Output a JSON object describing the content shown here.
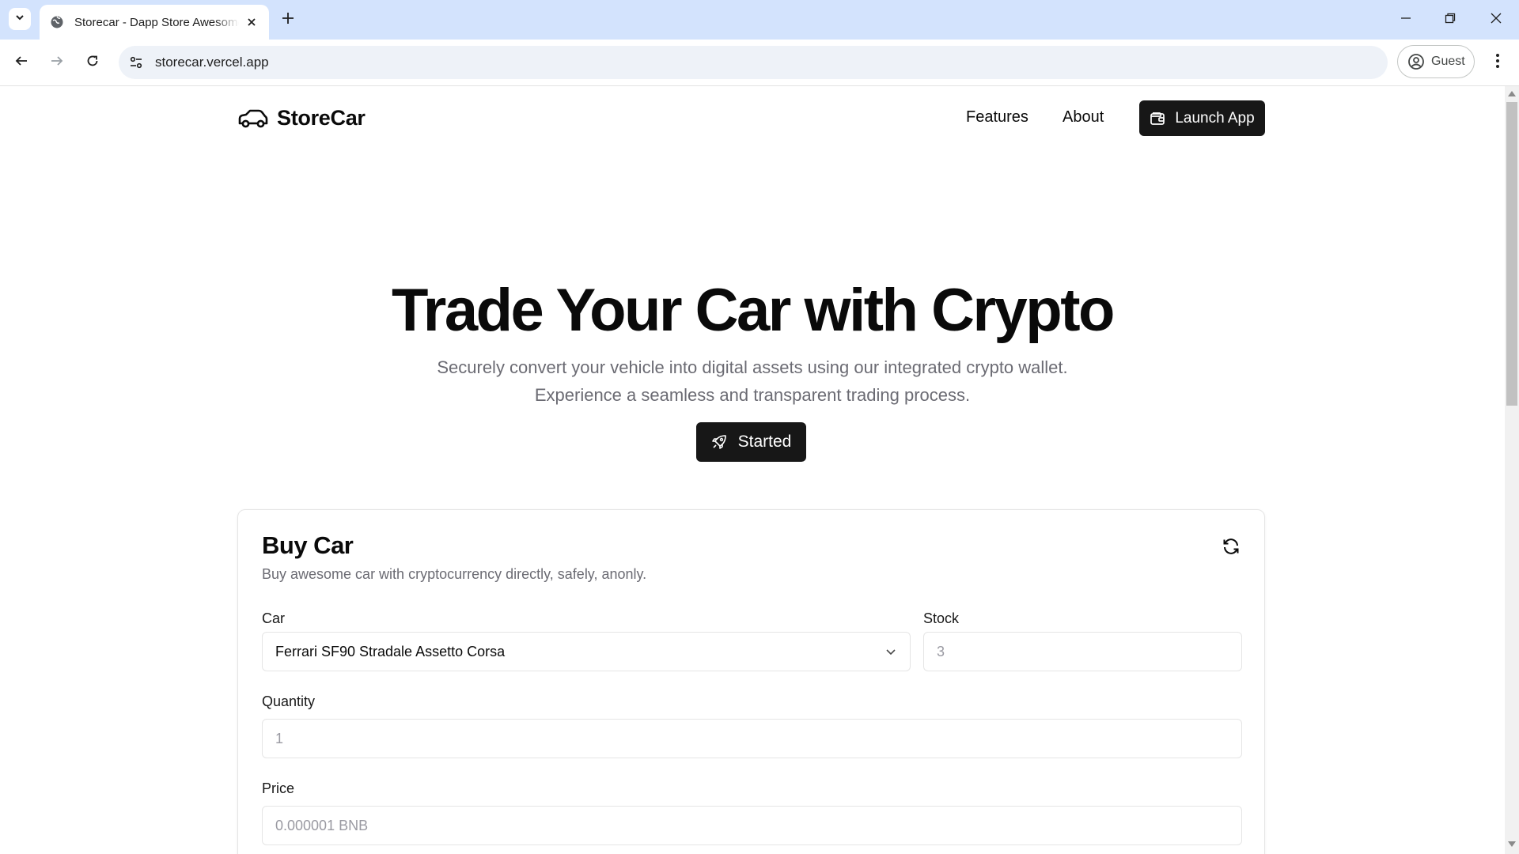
{
  "browser": {
    "tab_title": "Storecar - Dapp Store Awesome",
    "url": "storecar.vercel.app",
    "profile_label": "Guest"
  },
  "site": {
    "brand": "StoreCar",
    "nav": [
      "Features",
      "About"
    ],
    "launch_label": "Launch App"
  },
  "hero": {
    "title": "Trade Your Car with Crypto",
    "subtitle_line1": "Securely convert your vehicle into digital assets using our integrated crypto wallet.",
    "subtitle_line2": "Experience a seamless and transparent trading process.",
    "cta_label": "Started"
  },
  "buy_card": {
    "title": "Buy Car",
    "description": "Buy awesome car with cryptocurrency directly, safely, anonly.",
    "car_label": "Car",
    "car_selected": "Ferrari SF90 Stradale Assetto Corsa",
    "stock_label": "Stock",
    "stock_placeholder": "3",
    "quantity_label": "Quantity",
    "quantity_placeholder": "1",
    "price_label": "Price",
    "price_placeholder": "0.000001 BNB"
  },
  "icons": {
    "tab_list": "chevron-down-icon",
    "favicon": "globe-icon",
    "tab_close": "close-icon",
    "new_tab": "plus-icon",
    "back": "arrow-left-icon",
    "forward": "arrow-right-icon",
    "reload": "reload-icon",
    "site_info": "tune-icon",
    "profile": "account-circle-icon",
    "menu": "more-vert-icon",
    "logo": "car-icon",
    "launch": "wallet-icon",
    "started": "rocket-icon",
    "refresh": "refresh-icon",
    "select": "chevron-down-icon"
  },
  "colors": {
    "tabbar_bg": "#d3e3fd",
    "primary_button": "#171717",
    "muted_text": "#6b6b73"
  }
}
